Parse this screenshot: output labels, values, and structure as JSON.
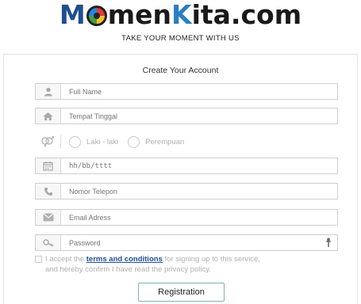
{
  "brand": {
    "part1": "M",
    "part2": "men",
    "part3": "K",
    "part4": "ita.com"
  },
  "tagline": "TAKE YOUR MOMENT WITH US",
  "form": {
    "title": "Create Your Account",
    "full_name_placeholder": "Full Name",
    "tempat_tinggal_placeholder": "Tempat Tinggal",
    "gender_options": [
      "Laki - laki",
      "Perempuan"
    ],
    "date_placeholder": "hh/bb/tttt",
    "phone_placeholder": "Nomor Telepon",
    "email_placeholder": "Email Adress",
    "password_placeholder": "Password"
  },
  "terms": {
    "prefix": "I accept the ",
    "link": "terms and conditions",
    "suffix": " for signing up to this service,",
    "line2": "and hereby confirm I have read the privacy policy."
  },
  "submit_label": "Registration",
  "colors": {
    "brand_dark_blue": "#1f4f91",
    "brand_blue": "#2a7ec2",
    "link": "#1e4c9a",
    "button_border": "#7fb0b8"
  },
  "icons": [
    "user-icon",
    "home-icon",
    "gender-icon",
    "calendar-icon",
    "phone-icon",
    "envelope-icon",
    "key-icon",
    "eye-icon"
  ]
}
